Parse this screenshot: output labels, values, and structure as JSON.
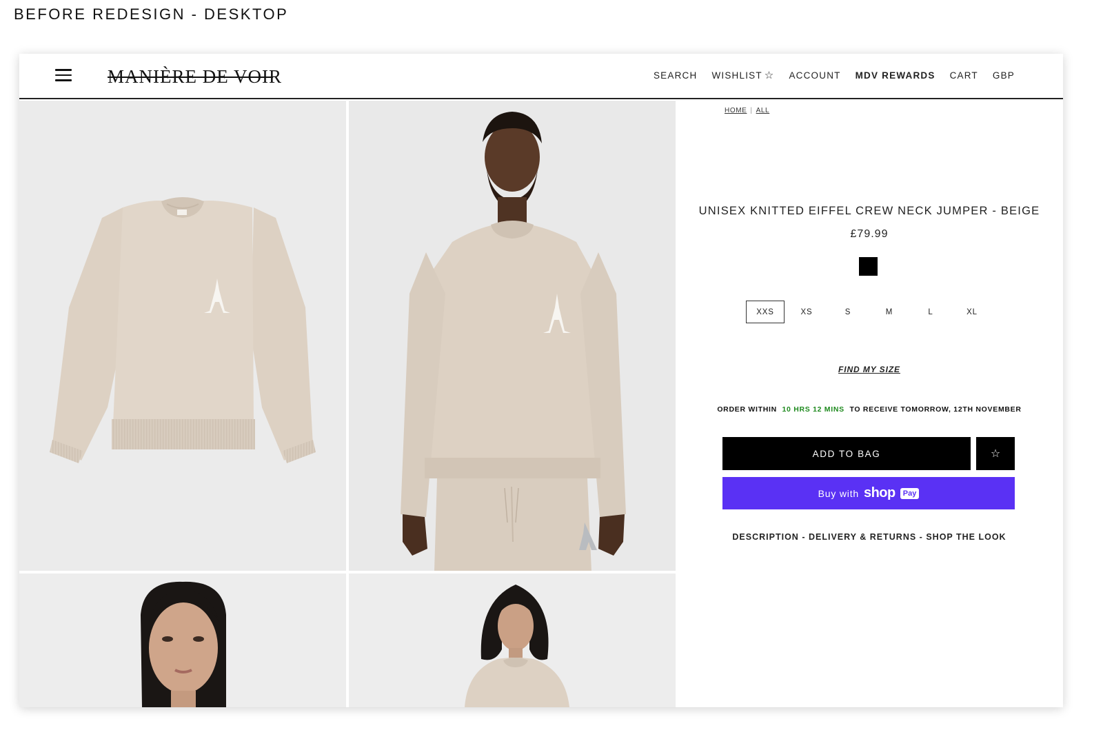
{
  "caption": "BEFORE REDESIGN - DESKTOP",
  "header": {
    "logo": "MANIÈRE DE VOIR",
    "nav": {
      "search": "SEARCH",
      "wishlist": "WISHLIST",
      "account": "ACCOUNT",
      "rewards": "MDV REWARDS",
      "cart": "CART",
      "currency": "GBP"
    }
  },
  "breadcrumb": {
    "home": "HOME",
    "separator": "|",
    "all": "ALL"
  },
  "product": {
    "title": "UNISEX KNITTED EIFFEL CREW NECK JUMPER - BEIGE",
    "price": "£79.99",
    "swatch_color": "#000000",
    "sizes": [
      "XXS",
      "XS",
      "S",
      "M",
      "L",
      "XL"
    ],
    "selected_size": "XXS",
    "find_my_size": "FIND MY SIZE",
    "delivery": {
      "prefix": "ORDER WITHIN",
      "timer": "10 HRS 12 MINS",
      "suffix": "TO RECEIVE TOMORROW, 12TH NOVEMBER"
    },
    "add_to_bag": "ADD TO BAG",
    "wishlist_icon": "☆",
    "shop_pay": {
      "buy_with": "Buy with",
      "shop": "shop",
      "pay": "Pay"
    },
    "links": {
      "description": "DESCRIPTION",
      "delivery": "DELIVERY & RETURNS",
      "shop_look": "SHOP THE LOOK",
      "sep": "-"
    }
  },
  "colors": {
    "shop_pay": "#5a31f4",
    "timer_green": "#1e8a1e",
    "sweater": "#ddd1c3"
  }
}
